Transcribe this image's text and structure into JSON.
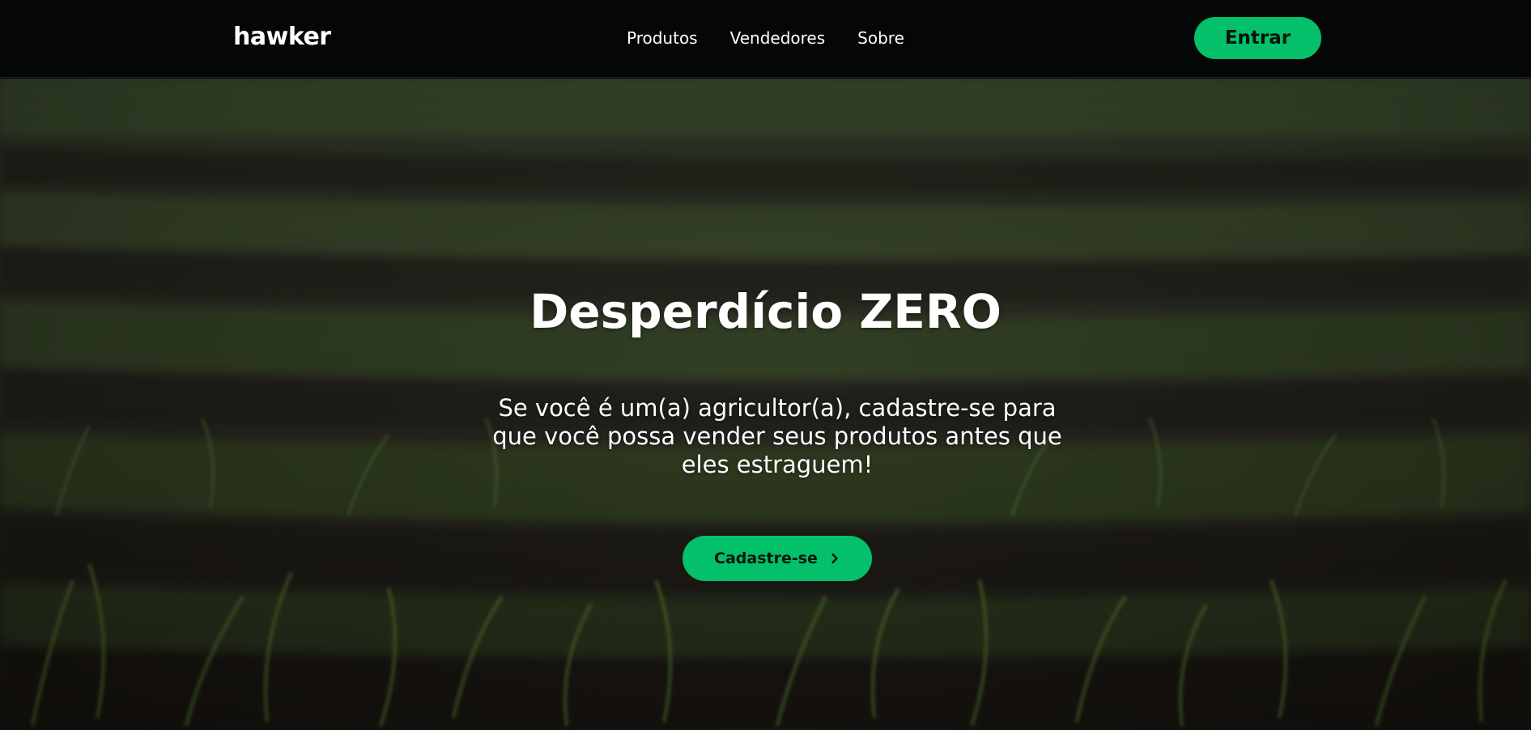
{
  "navbar": {
    "logo": "hawker",
    "links": [
      "Produtos",
      "Vendedores",
      "Sobre"
    ],
    "login_label": "Entrar"
  },
  "hero": {
    "title": "Desperdício ZERO",
    "subtitle_lines": [
      "Se você é um(a) agricultor(a), cadastre-se para",
      "que você possa vender seus produtos antes que",
      "eles estraguem!"
    ],
    "cta_label": "Cadastre-se",
    "cta_icon": "chevron-right-icon"
  },
  "colors": {
    "navbar_bg": "#050707",
    "accent": "#04c06a",
    "text": "#ffffff"
  }
}
